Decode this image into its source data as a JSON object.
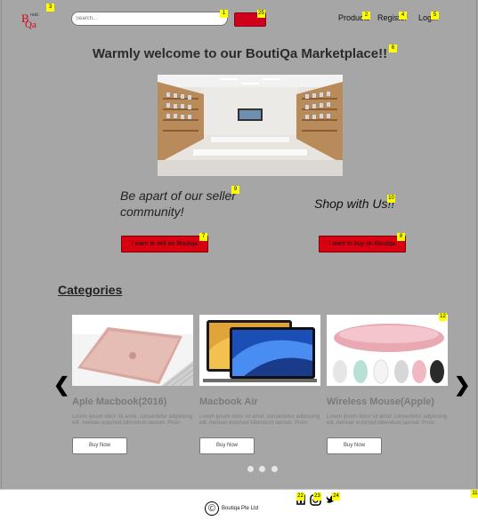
{
  "header": {
    "logo": {
      "l1": "B",
      "l2": "outi",
      "l3": "Qa"
    },
    "search_placeholder": "Search...",
    "nav": [
      "Products",
      "Register",
      "Login"
    ]
  },
  "hero": {
    "welcome": "Warmly welcome to our BoutiQa Marketplace!!",
    "seller_text": "Be apart of our seller community!",
    "shop_text": "Shop with Us!!",
    "sell_button": "I want to sell on Boutiqa",
    "buy_button": "I want to buy on Boutiqa"
  },
  "categories": {
    "title": "Categories",
    "prev_icon": "chevron-left-icon",
    "next_icon": "chevron-right-icon",
    "items": [
      {
        "name": "Aple Macbook(2016)",
        "desc": "Lorem ipsum dolor sit amet, consectetur adipiscing elit. Aenean euismod bibendum laoreet. Proin",
        "buy": "Buy Now"
      },
      {
        "name": "Macbook Air",
        "desc": "Lorem ipsum dolor sit amet, consectetur adipiscing elit. Aenean euismod bibendum laoreet. Proin",
        "buy": "Buy Now"
      },
      {
        "name": "Wireless Mouse(Apple)",
        "desc": "Lorem ipsum dolor sit amet, consectetur adipiscing elit. Aenean euismod bibendum laoreet. Proin",
        "buy": "Buy Now"
      }
    ]
  },
  "footer": {
    "copyright": "Boutiqa Pte Ltd",
    "copyright_icon": "©",
    "social_icons": [
      "facebook-icon",
      "instagram-icon",
      "twitter-icon"
    ]
  },
  "markers": {
    "m1": "1",
    "m2": "2",
    "m3": "3",
    "m4": "4",
    "m5": "5",
    "m6": "6",
    "m7": "7",
    "m8": "8",
    "m9": "9",
    "m10": "10",
    "m11": "11",
    "m12": "12",
    "m22": "22",
    "m23": "23",
    "m24": "24",
    "m25": "25"
  }
}
